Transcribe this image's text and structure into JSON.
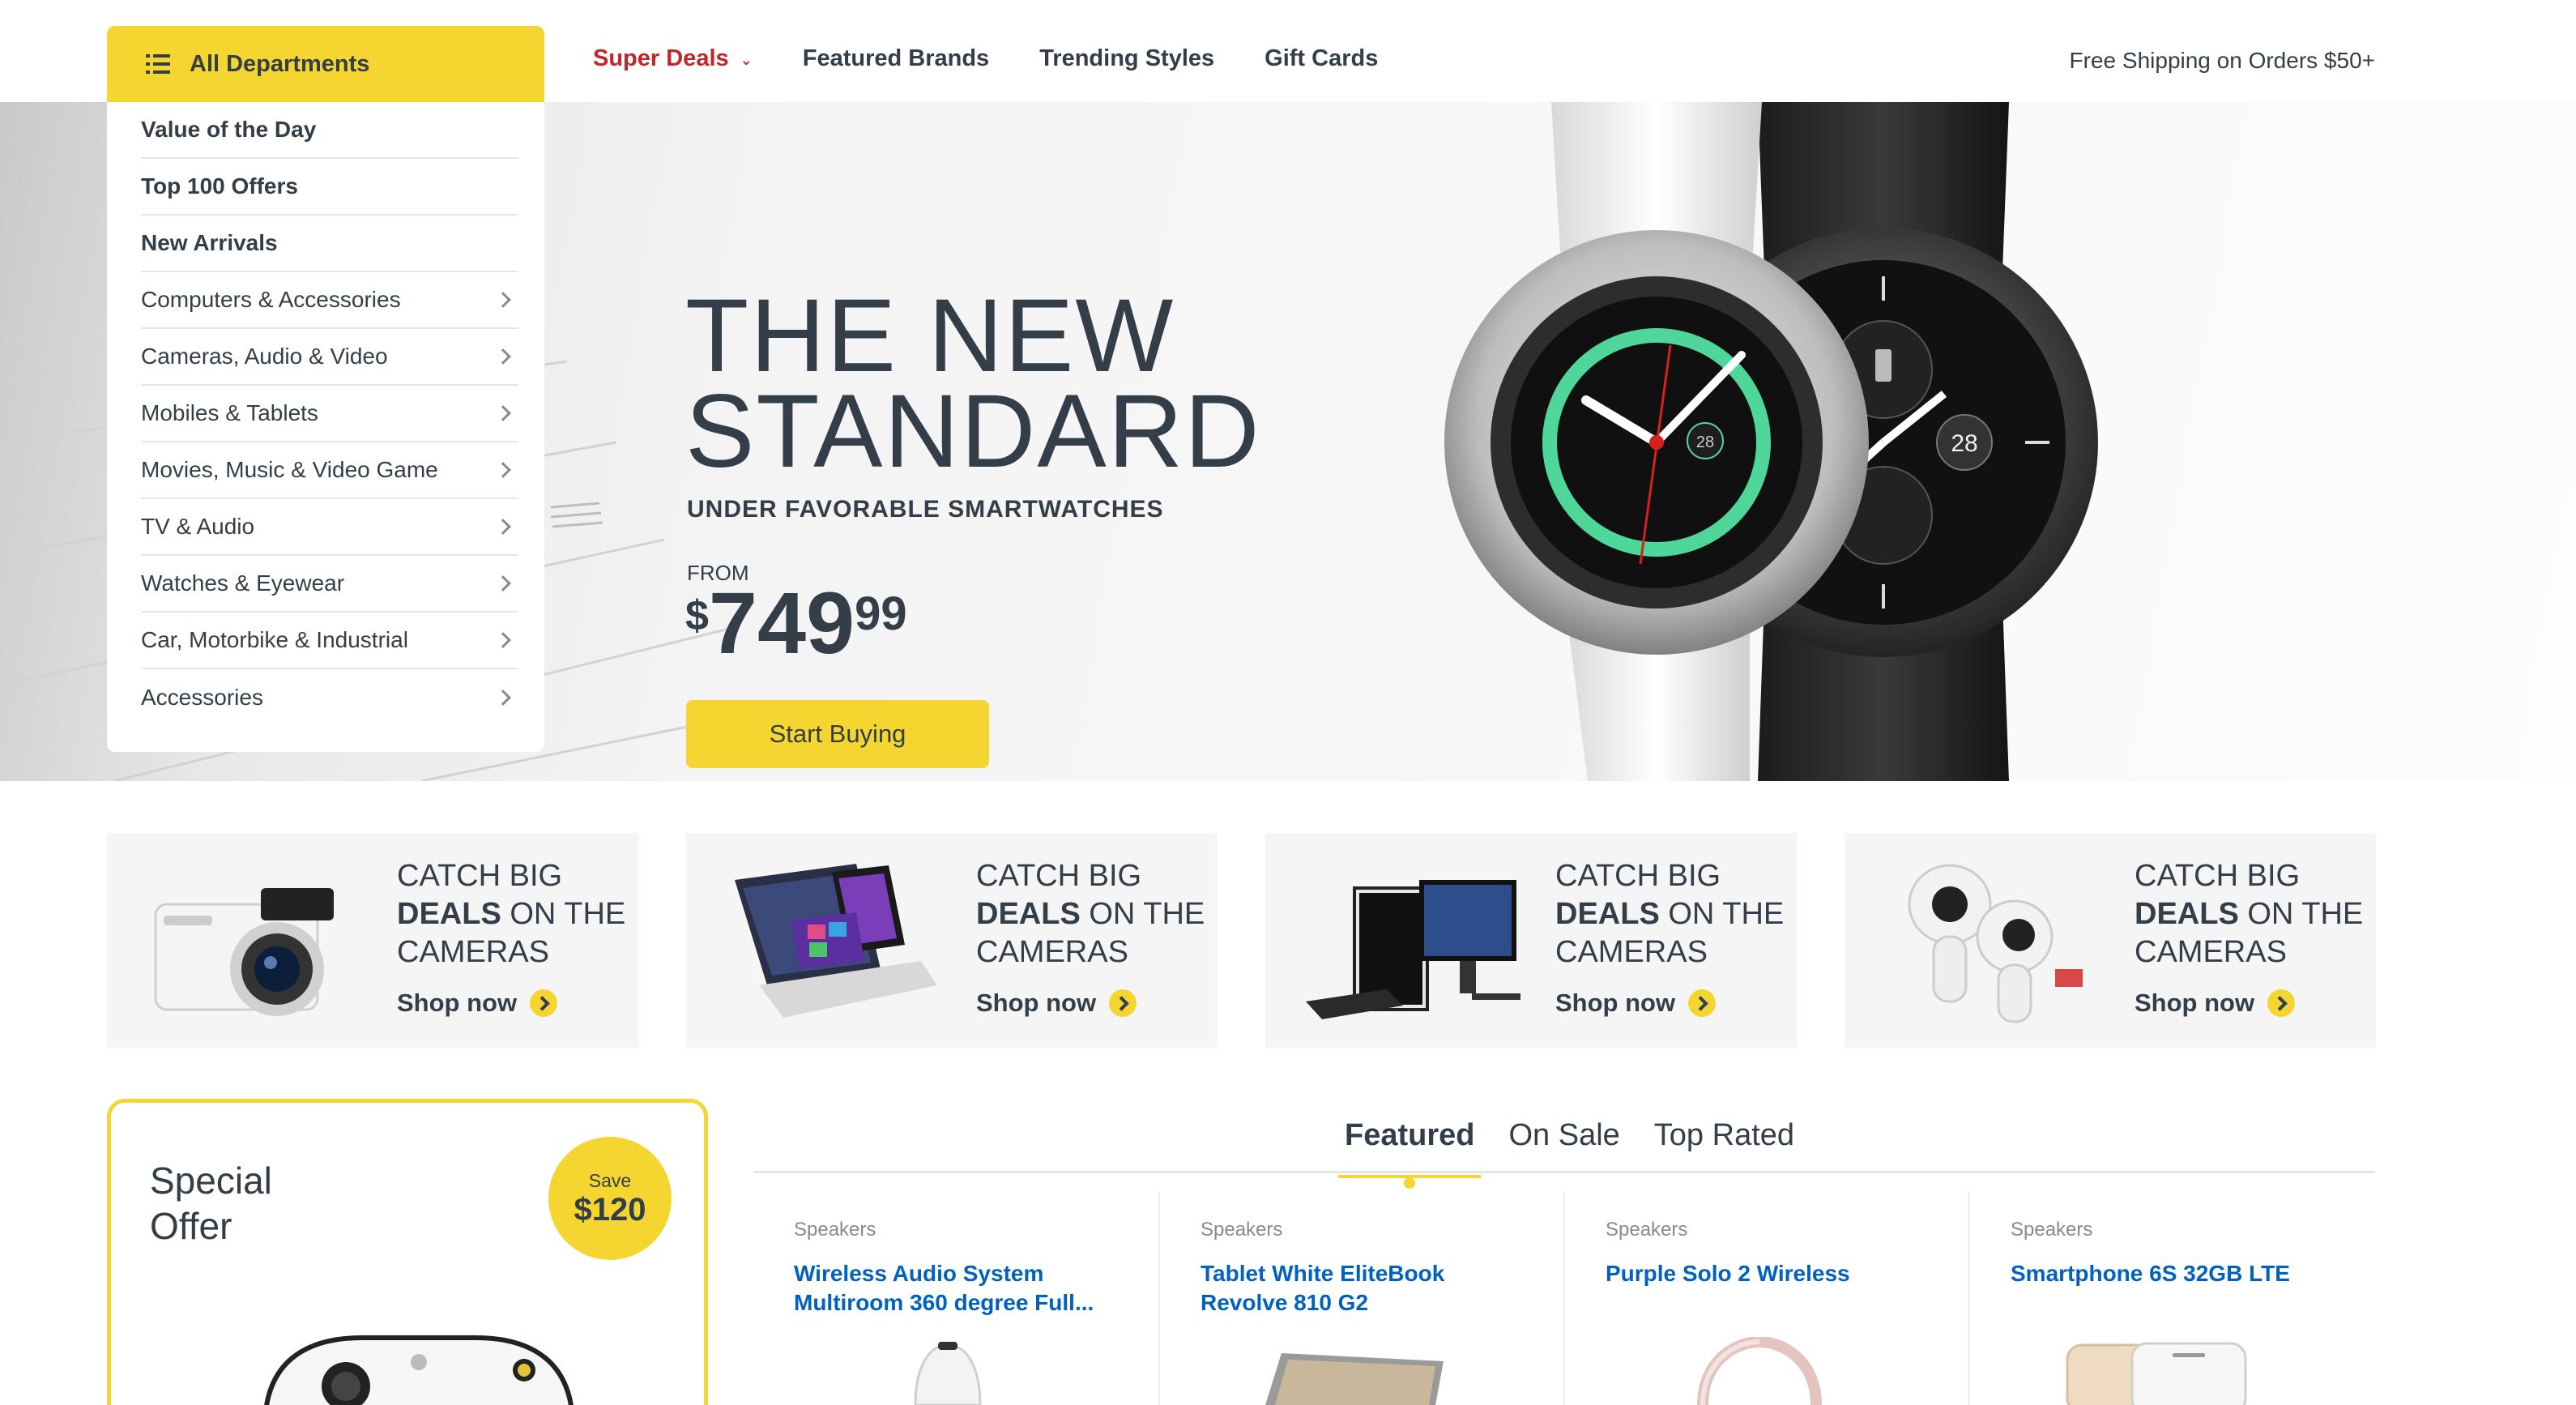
{
  "nav": {
    "departments_label": "All Departments",
    "links": [
      "Super Deals",
      "Featured Brands",
      "Trending Styles",
      "Gift Cards"
    ],
    "shipping_text": "Free Shipping on Orders $50+"
  },
  "departments": [
    {
      "label": "Value of the Day",
      "bold": true,
      "arrow": false
    },
    {
      "label": "Top 100 Offers",
      "bold": true,
      "arrow": false
    },
    {
      "label": "New Arrivals",
      "bold": true,
      "arrow": false
    },
    {
      "label": "Computers & Accessories",
      "bold": false,
      "arrow": true
    },
    {
      "label": "Cameras, Audio & Video",
      "bold": false,
      "arrow": true
    },
    {
      "label": "Mobiles & Tablets",
      "bold": false,
      "arrow": true
    },
    {
      "label": "Movies, Music & Video Game",
      "bold": false,
      "arrow": true
    },
    {
      "label": "TV & Audio",
      "bold": false,
      "arrow": true
    },
    {
      "label": "Watches & Eyewear",
      "bold": false,
      "arrow": true
    },
    {
      "label": "Car, Motorbike & Industrial",
      "bold": false,
      "arrow": true
    },
    {
      "label": "Accessories",
      "bold": false,
      "arrow": true
    }
  ],
  "hero": {
    "title_line1": "THE NEW",
    "title_line2": "STANDARD",
    "subtitle": "UNDER FAVORABLE SMARTWATCHES",
    "from_label": "FROM",
    "price_currency": "$",
    "price_int": "749",
    "price_cents": "99",
    "cta_label": "Start Buying",
    "slide_count": 3,
    "active_slide": 1,
    "watch_date": "28"
  },
  "promos": [
    {
      "line1": "CATCH BIG",
      "bold": "DEALS",
      "line2_rest": " ON THE",
      "line3": "CAMERAS",
      "shop_label": "Shop now",
      "image": "camera"
    },
    {
      "line1": "CATCH BIG",
      "bold": "DEALS",
      "line2_rest": " ON THE",
      "line3": "CAMERAS",
      "shop_label": "Shop now",
      "image": "laptop-tablet"
    },
    {
      "line1": "CATCH BIG",
      "bold": "DEALS",
      "line2_rest": " ON THE",
      "line3": "CAMERAS",
      "shop_label": "Shop now",
      "image": "desktop-pc"
    },
    {
      "line1": "CATCH BIG",
      "bold": "DEALS",
      "line2_rest": " ON THE",
      "line3": "CAMERAS",
      "shop_label": "Shop now",
      "image": "360-camera"
    }
  ],
  "special_offer": {
    "title_line1": "Special",
    "title_line2": "Offer",
    "save_label": "Save",
    "save_amount": "$120"
  },
  "tabs": [
    {
      "label": "Featured",
      "active": true
    },
    {
      "label": "On Sale",
      "active": false
    },
    {
      "label": "Top Rated",
      "active": false
    }
  ],
  "products": [
    {
      "category": "Speakers",
      "name": "Wireless Audio System Multiroom 360 degree Full..."
    },
    {
      "category": "Speakers",
      "name": "Tablet White EliteBook Revolve 810 G2"
    },
    {
      "category": "Speakers",
      "name": "Purple Solo 2 Wireless"
    },
    {
      "category": "Speakers",
      "name": "Smartphone 6S 32GB LTE"
    }
  ],
  "colors": {
    "accent_yellow": "#f5d631",
    "deal_red": "#c4252a",
    "link_blue": "#0062bd",
    "text_dark": "#333e48"
  }
}
